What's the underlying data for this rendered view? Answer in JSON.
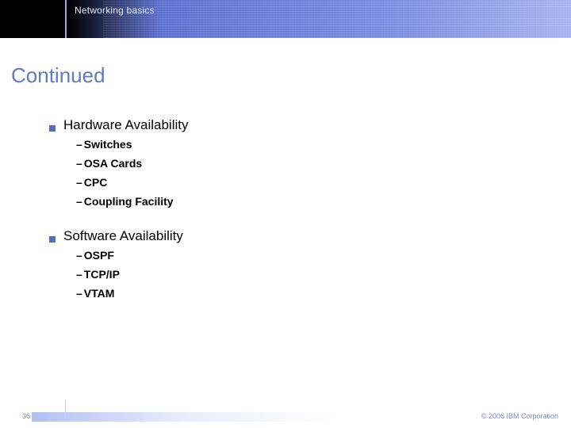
{
  "header": {
    "topic": "Networking basics"
  },
  "title": "Continued",
  "sections": [
    {
      "heading": "Hardware Availability",
      "items": [
        "Switches",
        "OSA Cards",
        "CPC",
        "Coupling Facility"
      ]
    },
    {
      "heading": "Software Availability",
      "items": [
        "OSPF",
        "TCP/IP",
        "VTAM"
      ]
    }
  ],
  "footer": {
    "page": "36",
    "copyright": "© 2006 IBM Corporation"
  }
}
